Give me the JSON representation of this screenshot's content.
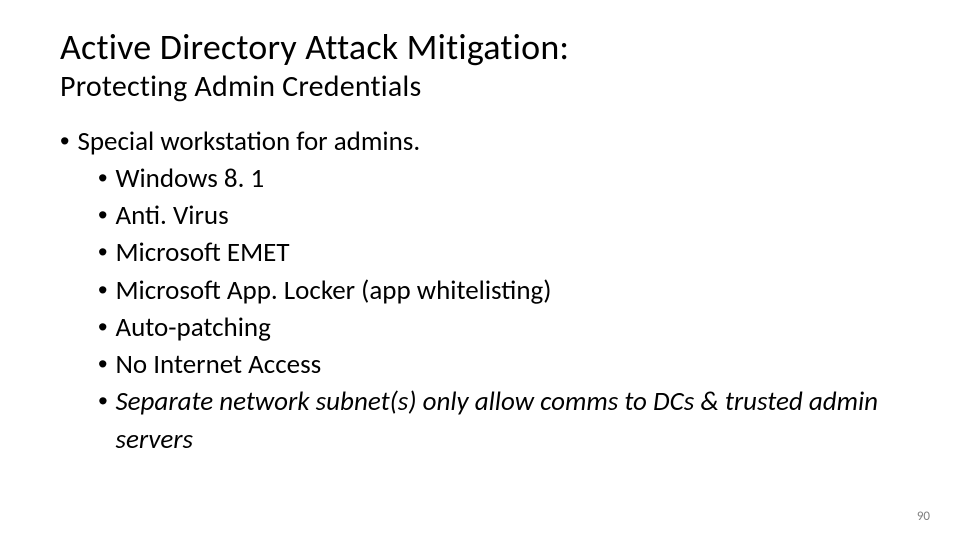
{
  "title": "Active Directory Attack Mitigation:",
  "subtitle": "Protecting Admin Credentials",
  "bullets": {
    "top": "Special workstation for admins.",
    "subs": [
      {
        "text": "Windows 8. 1",
        "italic": false
      },
      {
        "text": "Anti. Virus",
        "italic": false
      },
      {
        "text": "Microsoft EMET",
        "italic": false
      },
      {
        "text": "Microsoft App. Locker (app whitelisting)",
        "italic": false
      },
      {
        "text": "Auto-patching",
        "italic": false
      },
      {
        "text": "No Internet Access",
        "italic": false
      },
      {
        "text": "Separate network subnet(s) only allow comms to DCs & trusted admin servers",
        "italic": true
      }
    ]
  },
  "slide_number": "90"
}
